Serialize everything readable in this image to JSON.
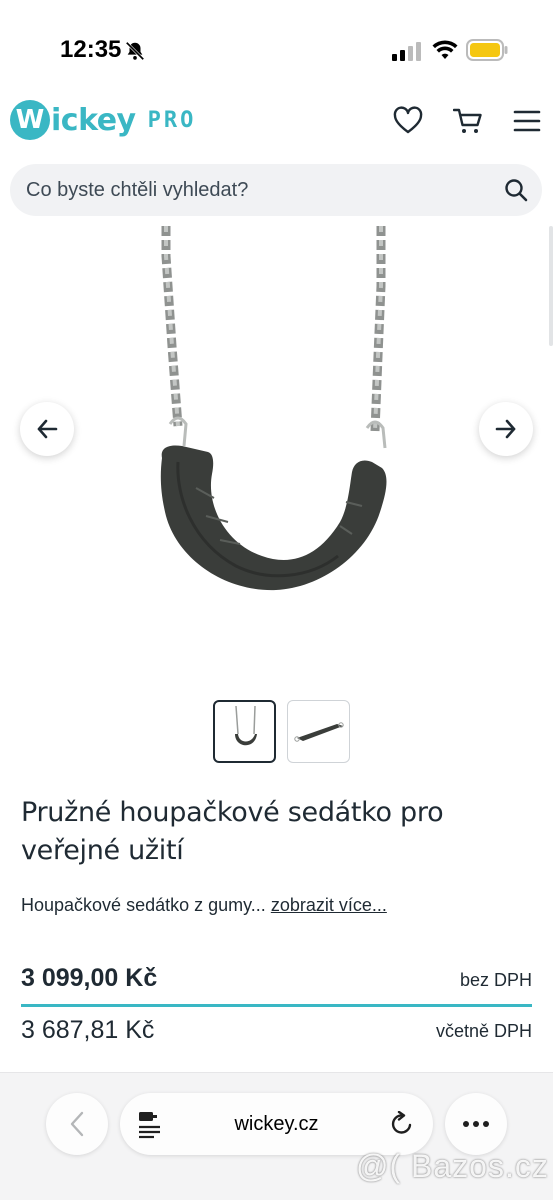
{
  "status_bar": {
    "time": "12:35"
  },
  "header": {
    "logo_badge": "W",
    "logo_text": "ickey",
    "logo_sub": "PRO"
  },
  "search": {
    "placeholder": "Co byste chtěli vyhledat?"
  },
  "product": {
    "title": "Pružné houpačkové sedátko pro veřejné užití",
    "description": "Houpačkové sedátko z gumy...",
    "more_link": "zobrazit více...",
    "price_net": "3 099,00 Kč",
    "price_net_note": "bez DPH",
    "price_gross": "3 687,81 Kč",
    "price_gross_note": "včetně DPH"
  },
  "browser": {
    "url": "wickey.cz"
  },
  "watermark": "@( Bazos.cz",
  "colors": {
    "brand": "#3ab7c4",
    "text": "#1f2a33",
    "seat": "#3a3d3a",
    "chain": "#a7aaa8"
  }
}
